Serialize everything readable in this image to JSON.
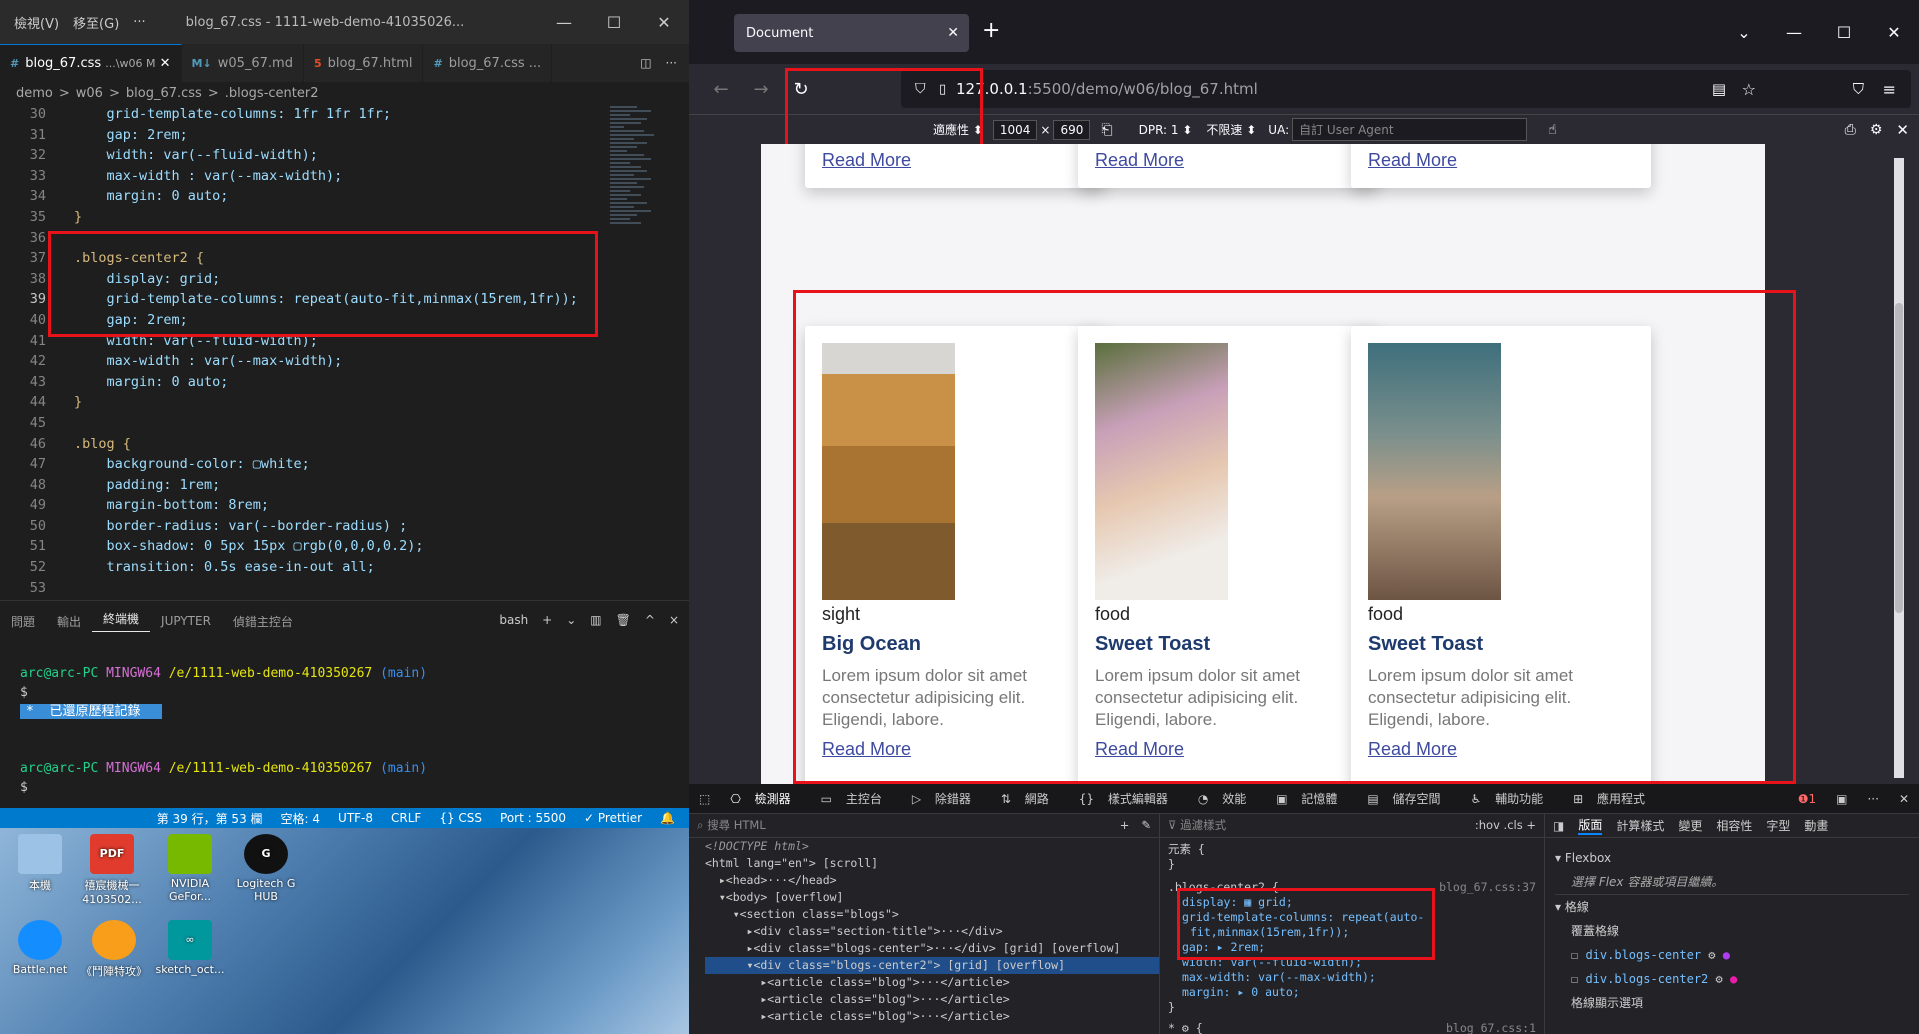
{
  "vscode": {
    "menu": [
      "檢視(V)",
      "移至(G)",
      "···"
    ],
    "title": "blog_67.css - 1111-web-demo-41035026...",
    "tabs": [
      {
        "label": "blog_67.css",
        "suffix": "...\\w06 M",
        "icon": "#",
        "active": true
      },
      {
        "label": "w05_67.md",
        "icon": "M↓"
      },
      {
        "label": "blog_67.html",
        "icon": "5"
      },
      {
        "label": "blog_67.css",
        "suffix": "...",
        "icon": "#"
      }
    ],
    "breadcrumb": [
      "demo",
      ">",
      "w06",
      ">",
      "blog_67.css",
      ">",
      ".blogs-center2"
    ],
    "code": [
      {
        "n": "30",
        "t": "    grid-template-columns: 1fr 1fr 1fr;"
      },
      {
        "n": "31",
        "t": "    gap: 2rem;"
      },
      {
        "n": "32",
        "t": "    width: var(--fluid-width);"
      },
      {
        "n": "33",
        "t": "    max-width : var(--max-width);"
      },
      {
        "n": "34",
        "t": "    margin: 0 auto;"
      },
      {
        "n": "35",
        "t": "}"
      },
      {
        "n": "36",
        "t": ""
      },
      {
        "n": "37",
        "t": ".blogs-center2 {"
      },
      {
        "n": "38",
        "t": "    display: grid;"
      },
      {
        "n": "39",
        "t": "    grid-template-columns: repeat(auto-fit,minmax(15rem,1fr));"
      },
      {
        "n": "40",
        "t": "    gap: 2rem;"
      },
      {
        "n": "41",
        "t": "    width: var(--fluid-width);"
      },
      {
        "n": "42",
        "t": "    max-width : var(--max-width);"
      },
      {
        "n": "43",
        "t": "    margin: 0 auto;"
      },
      {
        "n": "44",
        "t": "}"
      },
      {
        "n": "45",
        "t": ""
      },
      {
        "n": "46",
        "t": ".blog {"
      },
      {
        "n": "47",
        "t": "    background-color: ▢white;"
      },
      {
        "n": "48",
        "t": "    padding: 1rem;"
      },
      {
        "n": "49",
        "t": "    margin-bottom: 8rem;"
      },
      {
        "n": "50",
        "t": "    border-radius: var(--border-radius) ;"
      },
      {
        "n": "51",
        "t": "    box-shadow: 0 5px 15px ▢rgb(0,0,0,0.2);"
      },
      {
        "n": "52",
        "t": "    transition: 0.5s ease-in-out all;"
      },
      {
        "n": "53",
        "t": ""
      }
    ],
    "panel_tabs": [
      "問題",
      "輸出",
      "終端機",
      "JUPYTER",
      "偵錯主控台"
    ],
    "panel_right": [
      "bash",
      "+",
      "⌄",
      "▥",
      "🗑",
      "^",
      "×"
    ],
    "terminal": {
      "user": "arc@arc-PC",
      "sys": "MINGW64",
      "path": "/e/1111-web-demo-410350267",
      "branch": "(main)",
      "prompt": "$",
      "restored": "已還原歷程記錄"
    },
    "status": [
      "第 39 行，第 53 欄",
      "空格: 4",
      "UTF-8",
      "CRLF",
      "{} CSS",
      "Port : 5500",
      "✓ Prettier"
    ]
  },
  "desktop": [
    {
      "label": "本機",
      "color": "#9cc3e6"
    },
    {
      "label": "禧宸機械一 4103502...",
      "color": "#e03b2c"
    },
    {
      "label": "NVIDIA GeFor...",
      "color": "#76b900"
    },
    {
      "label": "Logitech G HUB",
      "color": "#111111"
    },
    {
      "label": "Battle.net",
      "color": "#148eff"
    },
    {
      "label": "《鬥陣特攻》",
      "color": "#f99e1a"
    },
    {
      "label": "sketch_oct...",
      "color": "#00979d"
    }
  ],
  "browser": {
    "tab_title": "Document",
    "url_host": "127.0.0.1",
    "url_rest": ":5500/demo/w06/blog_67.html",
    "rdm": {
      "mode": "適應性 ⬍",
      "w": "1004",
      "x": "×",
      "h": "690",
      "dpr": "DPR: 1 ⬍",
      "throttle": "不限速 ⬍",
      "ua_label": "UA:",
      "ua_placeholder": "自訂 User Agent"
    },
    "top_links": [
      "Read More",
      "Read More",
      "Read More"
    ],
    "cards": [
      {
        "tag": "sight",
        "title": "Big Ocean",
        "text": "Lorem ipsum dolor sit amet consectetur adipisicing elit. Eligendi, labore.",
        "link": "Read More"
      },
      {
        "tag": "food",
        "title": "Sweet Toast",
        "text": "Lorem ipsum dolor sit amet consectetur adipisicing elit. Eligendi, labore.",
        "link": "Read More"
      },
      {
        "tag": "food",
        "title": "Sweet Toast",
        "text": "Lorem ipsum dolor sit amet consectetur adipisicing elit. Eligendi, labore.",
        "link": "Read More"
      }
    ]
  },
  "devtools": {
    "tabs": [
      "檢測器",
      "主控台",
      "除錯器",
      "網路",
      "樣式編輯器",
      "效能",
      "記憶體",
      "儲存空間",
      "輔助功能",
      "應用程式"
    ],
    "search_placeholder": "搜尋 HTML",
    "html": [
      "<!DOCTYPE html>",
      "<html lang=\"en\"> [scroll]",
      "  ▸<head>···</head>",
      "  ▾<body> [overflow]",
      "    ▾<section class=\"blogs\">",
      "      ▸<div class=\"section-title\">···</div>",
      "      ▸<div class=\"blogs-center\">···</div> [grid] [overflow]",
      "      ▾<div class=\"blogs-center2\"> [grid] [overflow]",
      "        ▸<article class=\"blog\">···</article>",
      "        ▸<article class=\"blog\">···</article>",
      "        ▸<article class=\"blog\">···</article>"
    ],
    "filter_placeholder": "過濾樣式",
    "css": {
      "el": "元素 {",
      "sel": ".blogs-center2 {",
      "src": "blog_67.css:37",
      "src2": "blog_67.css:1",
      "rules": [
        "display: ▦ grid;",
        "grid-template-columns: repeat(auto-",
        "fit,minmax(15rem,1fr));",
        "gap: ▸ 2rem;",
        "width: var(--fluid-width);",
        "max-width: var(--max-width);",
        "margin: ▸ 0 auto;"
      ]
    },
    "layout_tabs": [
      "版面",
      "計算樣式",
      "變更",
      "相容性",
      "字型",
      "動畫"
    ],
    "flexbox": "Flexbox",
    "flex_hint": "選擇 Flex 容器或項目繼續。",
    "grid": "格線",
    "overlay": "覆蓋格線",
    "grids": [
      "div.blogs-center",
      "div.blogs-center2"
    ],
    "display_opts": "格線顯示選項"
  }
}
